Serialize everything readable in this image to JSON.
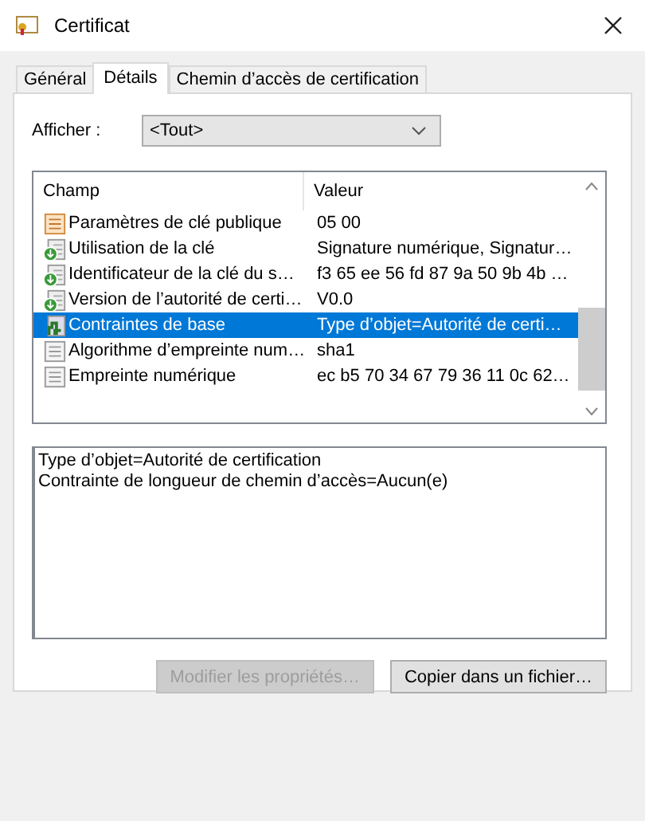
{
  "window": {
    "title": "Certificat"
  },
  "tabs": [
    {
      "label": "Général",
      "selected": false
    },
    {
      "label": "Détails",
      "selected": true
    },
    {
      "label": "Chemin d’accès de certification",
      "selected": false
    }
  ],
  "show": {
    "label": "Afficher :",
    "value": "<Tout>"
  },
  "table": {
    "columns": [
      "Champ",
      "Valeur"
    ],
    "rows": [
      {
        "kind": "property",
        "field": "Paramètres de clé publique",
        "value": "05 00",
        "selected": false
      },
      {
        "kind": "extension",
        "field": "Utilisation de la clé",
        "value": "Signature numérique, Signatur…",
        "selected": false
      },
      {
        "kind": "extension",
        "field": "Identificateur de la clé du s…",
        "value": "f3 65 ee 56 fd 87 9a 50 9b 4b …",
        "selected": false
      },
      {
        "kind": "extension",
        "field": "Version de l’autorité de certi…",
        "value": "V0.0",
        "selected": false
      },
      {
        "kind": "constraint",
        "field": "Contraintes de base",
        "value": "Type d’objet=Autorité de certi…",
        "selected": true
      },
      {
        "kind": "plain",
        "field": "Algorithme d’empreinte num…",
        "value": "sha1",
        "selected": false
      },
      {
        "kind": "plain",
        "field": "Empreinte numérique",
        "value": "ec b5 70 34 67 79 36 11 0c 62…",
        "selected": false
      }
    ]
  },
  "detail": {
    "lines": [
      "Type d’objet=Autorité de certification",
      "Contrainte de longueur de chemin d’accès=Aucun(e)"
    ]
  },
  "buttons": [
    {
      "label": "Modifier les propriétés…",
      "disabled": true
    },
    {
      "label": "Copier dans un fichier…",
      "disabled": false
    }
  ]
}
